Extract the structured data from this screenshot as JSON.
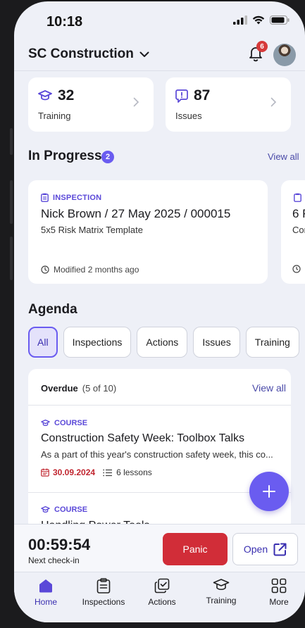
{
  "status_bar": {
    "time": "10:18"
  },
  "header": {
    "org_name": "SC Construction",
    "notification_count": "6"
  },
  "stats": [
    {
      "value": "32",
      "label": "Training",
      "icon": "graduation-cap-icon"
    },
    {
      "value": "87",
      "label": "Issues",
      "icon": "alert-bubble-icon"
    }
  ],
  "in_progress": {
    "title": "In Progress",
    "count": "2",
    "view_all": "View all",
    "cards": [
      {
        "type": "INSPECTION",
        "title": "Nick Brown / 27 May 2025 / 000015",
        "subtitle": "5x5 Risk Matrix Template",
        "modified": "Modified 2 months ago"
      },
      {
        "type": "",
        "title": "6 F",
        "subtitle": "Cor",
        "modified": ""
      }
    ]
  },
  "agenda": {
    "title": "Agenda",
    "filters": [
      "All",
      "Inspections",
      "Actions",
      "Issues",
      "Training"
    ],
    "active_filter": "All",
    "overdue_label": "Overdue",
    "overdue_count": "(5 of 10)",
    "view_all": "View all",
    "items": [
      {
        "type": "COURSE",
        "title": "Construction Safety Week: Toolbox Talks",
        "description": "As a part of this year's construction safety week, this co...",
        "due": "30.09.2024",
        "lessons": "6 lessons"
      },
      {
        "type": "COURSE",
        "title": "Handling Power Tools",
        "description": "",
        "due": "",
        "lessons": ""
      }
    ]
  },
  "checkin": {
    "timer": "00:59:54",
    "label": "Next check-in",
    "panic": "Panic",
    "open": "Open"
  },
  "tabbar": [
    {
      "label": "Home",
      "icon": "home-icon"
    },
    {
      "label": "Inspections",
      "icon": "clipboard-icon"
    },
    {
      "label": "Actions",
      "icon": "actions-check-icon"
    },
    {
      "label": "Training",
      "icon": "graduation-cap-icon"
    },
    {
      "label": "More",
      "icon": "grid-icon"
    }
  ],
  "colors": {
    "accent": "#6a5cf0",
    "panic": "#d12d38",
    "background": "#eef0f7",
    "overdue": "#c0252f"
  }
}
